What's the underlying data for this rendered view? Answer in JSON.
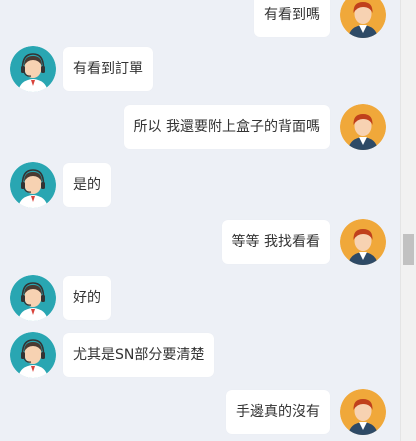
{
  "colors": {
    "background": "#edf0f6",
    "bubble": "#ffffff",
    "text": "#333333",
    "agent_avatar_bg": "#29a6b2",
    "user_avatar_bg": "#f0a83a"
  },
  "messages": [
    {
      "sender": "user",
      "avatar": "user-avatar-icon",
      "text": "有看到嗎"
    },
    {
      "sender": "agent",
      "avatar": "agent-headset-avatar-icon",
      "text": "有看到訂單"
    },
    {
      "sender": "user",
      "avatar": "user-avatar-icon",
      "text": "所以 我還要附上盒子的背面嗎"
    },
    {
      "sender": "agent",
      "avatar": "agent-headset-avatar-icon",
      "text": "是的"
    },
    {
      "sender": "user",
      "avatar": "user-avatar-icon",
      "text": "等等 我找看看"
    },
    {
      "sender": "agent",
      "avatar": "agent-headset-avatar-icon",
      "text": "好的"
    },
    {
      "sender": "agent",
      "avatar": "agent-headset-avatar-icon",
      "text": "尤其是SN部分要清楚"
    },
    {
      "sender": "user",
      "avatar": "user-avatar-icon",
      "text": "手邊真的沒有"
    }
  ]
}
